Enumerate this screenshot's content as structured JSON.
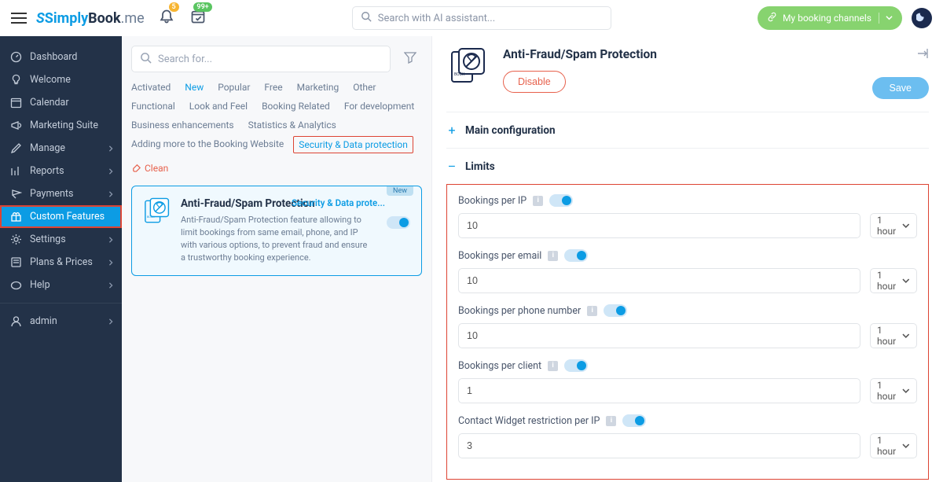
{
  "header": {
    "logo_main": "Simply",
    "logo_book": "Book",
    "logo_me": ".me",
    "notif_count": "5",
    "cal_badge": "99+",
    "search_placeholder": "Search with AI assistant...",
    "channels_label": "My booking channels"
  },
  "sidebar": {
    "items": [
      {
        "label": "Dashboard",
        "icon": "dashboard",
        "chev": false
      },
      {
        "label": "Welcome",
        "icon": "bulb",
        "chev": false
      },
      {
        "label": "Calendar",
        "icon": "calendar",
        "chev": false
      },
      {
        "label": "Marketing Suite",
        "icon": "megaphone",
        "chev": false
      },
      {
        "label": "Manage",
        "icon": "pencil",
        "chev": true
      },
      {
        "label": "Reports",
        "icon": "chart",
        "chev": true
      },
      {
        "label": "Payments",
        "icon": "payments",
        "chev": true
      },
      {
        "label": "Custom Features",
        "icon": "gift",
        "chev": false,
        "active": true,
        "highlight": true
      },
      {
        "label": "Settings",
        "icon": "settings",
        "chev": true
      },
      {
        "label": "Plans & Prices",
        "icon": "plans",
        "chev": true
      },
      {
        "label": "Help",
        "icon": "help",
        "chev": true
      }
    ],
    "admin_label": "admin"
  },
  "center": {
    "search_placeholder": "Search for...",
    "tags_row1": [
      {
        "label": "Activated"
      },
      {
        "label": "New",
        "blue": true
      },
      {
        "label": "Popular"
      },
      {
        "label": "Free"
      },
      {
        "label": "Marketing"
      },
      {
        "label": "Other"
      }
    ],
    "tags_row2": [
      {
        "label": "Functional"
      },
      {
        "label": "Look and Feel"
      },
      {
        "label": "Booking Related"
      },
      {
        "label": "For development"
      }
    ],
    "tags_row3": [
      {
        "label": "Business enhancements"
      },
      {
        "label": "Statistics & Analytics"
      }
    ],
    "tags_row4": [
      {
        "label": "Adding more to the Booking Website"
      },
      {
        "label": "Security & Data protection",
        "blue": true,
        "boxed": true
      },
      {
        "label": "Clean",
        "clean": true
      }
    ],
    "card": {
      "badge": "New",
      "title": "Anti-Fraud/Spam Protection",
      "category": "Security & Data prote...",
      "description": "Anti-Fraud/Spam Protection feature allowing to limit bookings from same email, phone, and IP with various options, to prevent fraud and ensure a trustworthy booking experience."
    }
  },
  "right": {
    "title": "Anti-Fraud/Spam Protection",
    "disable_label": "Disable",
    "save_label": "Save",
    "section1": "Main configuration",
    "section2": "Limits",
    "limits": [
      {
        "label": "Bookings per IP",
        "value": "10",
        "period": "1 hour"
      },
      {
        "label": "Bookings per email",
        "value": "10",
        "period": "1 hour"
      },
      {
        "label": "Bookings per phone number",
        "value": "10",
        "period": "1 hour"
      },
      {
        "label": "Bookings per client",
        "value": "1",
        "period": "1 hour"
      },
      {
        "label": "Contact Widget restriction per IP",
        "value": "3",
        "period": "1 hour"
      }
    ]
  }
}
